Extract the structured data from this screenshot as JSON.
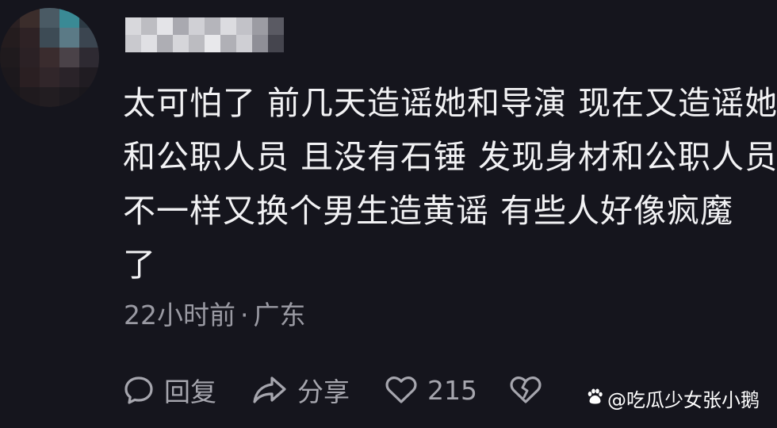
{
  "comment": {
    "lines": [
      "太可怕了 前几天造谣她和导演 现在又造谣她",
      "和公职人员 且没有石锤 发现身材和公职人员",
      "不一样又换个男生造黄谣 有些人好像疯魔",
      "了"
    ],
    "time": "22小时前",
    "separator": "·",
    "location": "广东"
  },
  "actions": {
    "reply_label": "回复",
    "share_label": "分享",
    "like_count": "215"
  },
  "watermark": {
    "text": "@吃瓜少女张小鹅"
  },
  "colors": {
    "background": "#15151d",
    "text": "#f2f2f4",
    "muted": "#9a9aa3"
  }
}
